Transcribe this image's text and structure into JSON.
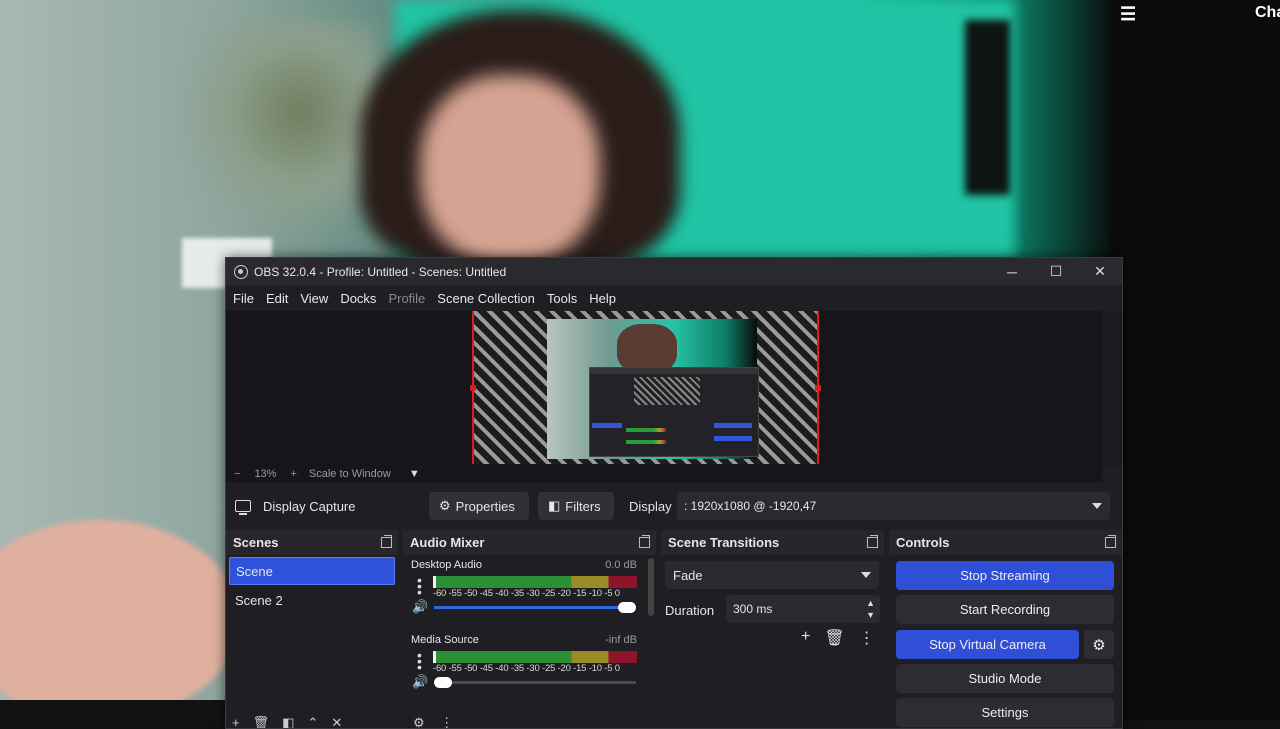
{
  "overlay": {
    "menu_icon": "hamburger-icon",
    "right_text": "Cha"
  },
  "window": {
    "title": "OBS 32.0.4 - Profile: Untitled - Scenes: Untitled",
    "controls": {
      "minimize": "─",
      "maximize": "☐",
      "close": "✕"
    }
  },
  "menu": [
    "File",
    "Edit",
    "View",
    "Docks",
    "Profile",
    "Scene Collection",
    "Tools",
    "Help"
  ],
  "zoom": {
    "minus": "−",
    "level": "13%",
    "plus": "+",
    "mode": "Scale to Window"
  },
  "source_toolbar": {
    "source": "Display Capture",
    "properties": "Properties",
    "filters": "Filters",
    "display_label": "Display",
    "display_value": ": 1920x1080 @ -1920,47"
  },
  "scenes": {
    "title": "Scenes",
    "items": [
      {
        "label": "Scene",
        "active": true
      },
      {
        "label": "Scene 2",
        "active": false
      }
    ]
  },
  "mixer": {
    "title": "Audio Mixer",
    "scale": "-60 -55 -50 -45 -40 -35 -30 -25 -20 -15 -10 -5  0",
    "channels": [
      {
        "name": "Desktop Audio",
        "db": "0.0 dB",
        "volume": 1.0
      },
      {
        "name": "Media Source",
        "db": "-inf dB",
        "volume": 0.0
      }
    ]
  },
  "transitions": {
    "title": "Scene Transitions",
    "selected": "Fade",
    "duration_label": "Duration",
    "duration_value": "300 ms"
  },
  "controls": {
    "title": "Controls",
    "stop_streaming": "Stop Streaming",
    "start_recording": "Start Recording",
    "stop_virtual_camera": "Stop Virtual Camera",
    "studio_mode": "Studio Mode",
    "settings": "Settings"
  },
  "colors": {
    "accent": "#2e4fd6",
    "window_bg": "#1f1f23",
    "preview_border": "#e01b1b"
  }
}
